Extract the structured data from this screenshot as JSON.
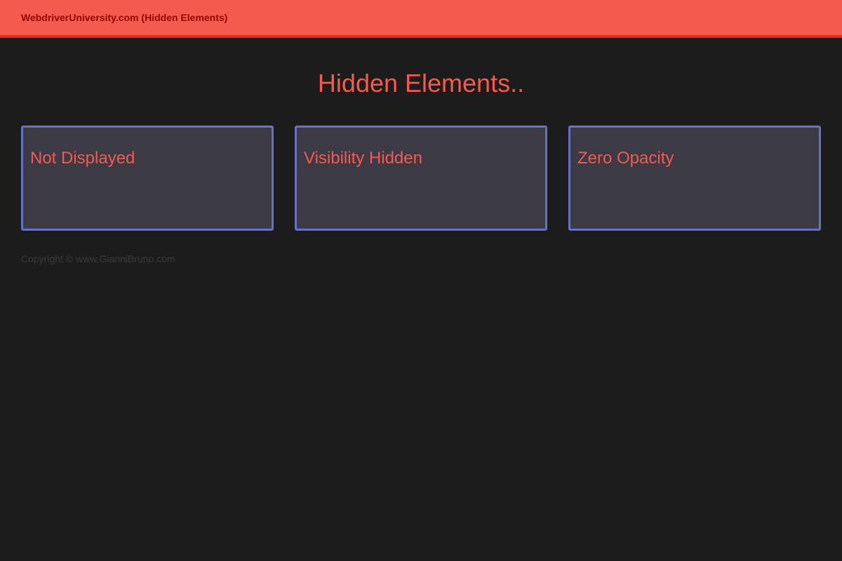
{
  "header": {
    "brand": "WebdriverUniversity.com (Hidden Elements)"
  },
  "main": {
    "title": "Hidden Elements..",
    "cards": [
      {
        "title": "Not Displayed"
      },
      {
        "title": "Visibility Hidden"
      },
      {
        "title": "Zero Opacity"
      }
    ]
  },
  "footer": {
    "copyright": "Copyright © www.GianniBruno.com"
  },
  "colors": {
    "background": "#1c1c1c",
    "navbar": "#f55a4e",
    "navbar_border": "#e8281c",
    "brand_text": "#8e0b04",
    "accent_text": "#f55a4e",
    "card_background": "#3b3a45",
    "card_border": "#6872c4",
    "footer_text": "#3a3a3a"
  }
}
